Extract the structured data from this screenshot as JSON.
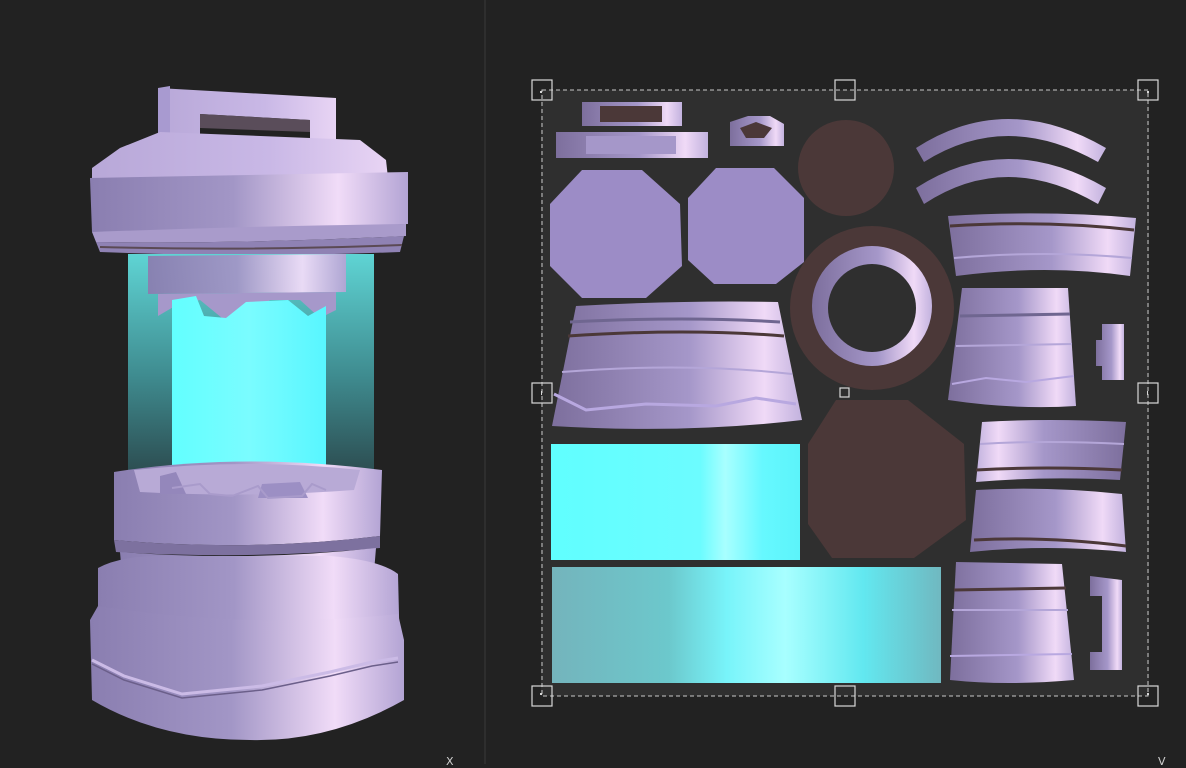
{
  "viewport_3d": {
    "axis_label": "X"
  },
  "viewport_uv": {
    "axis_label": "V"
  },
  "colors": {
    "background": "#222222",
    "uv_area": "#2f2f2f",
    "metal_light": "#efd8f6",
    "metal_mid": "#9c8cc6",
    "metal_dark": "#6f6690",
    "glow": "#66ffff",
    "glow_light": "#aaffff",
    "rubber": "#4b3838",
    "selection": "#c8c8c8"
  },
  "icons": {
    "transform_handle": "square-handle-icon",
    "pivot": "pivot-square-icon"
  }
}
